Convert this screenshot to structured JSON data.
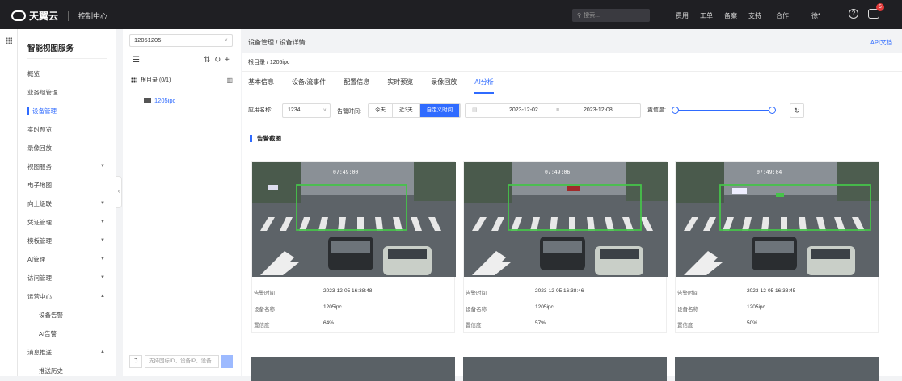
{
  "topbar": {
    "brand": "天翼云",
    "console": "控制中心",
    "search_placeholder": "搜索...",
    "links": [
      "费用",
      "工单",
      "备案",
      "支持",
      "合作",
      "徐*"
    ],
    "badge_count": "5"
  },
  "sidebar": {
    "title": "智能视图服务",
    "items": [
      {
        "label": "概览",
        "expandable": false
      },
      {
        "label": "业务组管理",
        "expandable": false
      },
      {
        "label": "设备管理",
        "expandable": false,
        "active": true
      },
      {
        "label": "实时预览",
        "expandable": false
      },
      {
        "label": "录像回放",
        "expandable": false
      },
      {
        "label": "视图服务",
        "expandable": true
      },
      {
        "label": "电子地图",
        "expandable": false
      },
      {
        "label": "向上级联",
        "expandable": true
      },
      {
        "label": "凭证管理",
        "expandable": true
      },
      {
        "label": "模板管理",
        "expandable": true
      },
      {
        "label": "AI管理",
        "expandable": true
      },
      {
        "label": "访问管理",
        "expandable": true
      },
      {
        "label": "运营中心",
        "expandable": true,
        "open": true
      },
      {
        "label": "设备告警",
        "sub": true
      },
      {
        "label": "AI告警",
        "sub": true
      },
      {
        "label": "消息推送",
        "expandable": true,
        "open": true
      },
      {
        "label": "推送历史",
        "sub": true
      }
    ]
  },
  "tree": {
    "select_value": "12051205",
    "root_label": "根目录 (0/1)",
    "node_label": "1205ipc",
    "search_placeholder": "支持国标ID、设备IP、设备"
  },
  "header": {
    "breadcrumb": "设备管理 / 设备详情",
    "api_link": "API文档"
  },
  "path": "根目录  /  1205ipc",
  "tabs": [
    {
      "label": "基本信息",
      "active": false
    },
    {
      "label": "设备/流事件",
      "active": false
    },
    {
      "label": "配置信息",
      "active": false
    },
    {
      "label": "实时预览",
      "active": false
    },
    {
      "label": "录像回放",
      "active": false
    },
    {
      "label": "AI分析",
      "active": true
    }
  ],
  "filters": {
    "app_label": "应用名称:",
    "app_value": "1234",
    "time_label": "告警时间:",
    "time_buttons": [
      "今天",
      "近3天",
      "自定义时间"
    ],
    "start_date": "2023-12-02",
    "end_date": "2023-12-08",
    "confidence_label": "置信度:"
  },
  "section_title": "告警截图",
  "field_labels": {
    "time": "告警时间",
    "device": "设备名称",
    "confidence": "置信度"
  },
  "alerts": [
    {
      "timestamp": "07:49:00",
      "time": "2023-12-05 16:38:48",
      "device": "1205ipc",
      "confidence": "64%"
    },
    {
      "timestamp": "07:49:06",
      "time": "2023-12-05 16:38:46",
      "device": "1205ipc",
      "confidence": "57%"
    },
    {
      "timestamp": "07:49:04",
      "time": "2023-12-05 16:38:45",
      "device": "1205ipc",
      "confidence": "50%"
    }
  ],
  "colors": {
    "accent": "#2f6bff",
    "topbar": "#1f1f23",
    "badge": "#e23b3b",
    "detect_box": "#46c24a"
  },
  "icons": [
    "cloud-logo-icon",
    "search-icon",
    "help-icon",
    "message-icon",
    "apps-grid-icon",
    "sort-icon",
    "refresh-icon",
    "add-icon",
    "camera-icon",
    "calendar-icon"
  ]
}
